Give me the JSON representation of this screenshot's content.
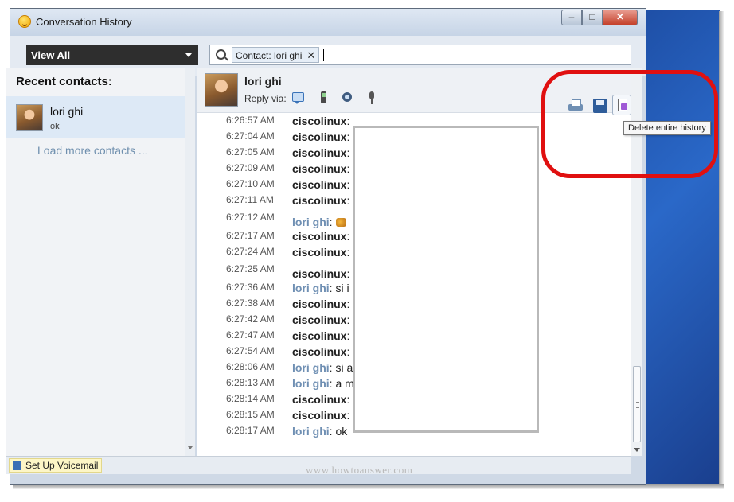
{
  "window": {
    "title": "Conversation History"
  },
  "toolbar": {
    "view_filter": "View All",
    "search_chip": "Contact: lori ghi"
  },
  "sidebar": {
    "heading": "Recent contacts:",
    "contacts": [
      {
        "name": "lori ghi",
        "status": "ok"
      }
    ],
    "load_more": "Load more contacts ..."
  },
  "conversation": {
    "contact_name": "lori ghi",
    "reply_via_label": "Reply via:",
    "tooltip": "Delete entire history",
    "messages": [
      {
        "time": "6:26:57 AM",
        "sender": "ciscolinux",
        "text": ":"
      },
      {
        "time": "6:27:04 AM",
        "sender": "ciscolinux",
        "text": ":"
      },
      {
        "time": "6:27:05 AM",
        "sender": "ciscolinux",
        "text": ":"
      },
      {
        "time": "6:27:09 AM",
        "sender": "ciscolinux",
        "text": ":"
      },
      {
        "time": "6:27:10 AM",
        "sender": "ciscolinux",
        "text": ":"
      },
      {
        "time": "6:27:11 AM",
        "sender": "ciscolinux",
        "text": ":"
      },
      {
        "time": "6:27:12 AM",
        "sender": "lori ghi",
        "text": ":"
      },
      {
        "time": "6:27:17 AM",
        "sender": "ciscolinux",
        "text": ":"
      },
      {
        "time": "6:27:24 AM",
        "sender": "ciscolinux",
        "text": ":"
      },
      {
        "time": "6:27:25 AM",
        "sender": "ciscolinux",
        "text": ":"
      },
      {
        "time": "6:27:36 AM",
        "sender": "lori ghi",
        "text": ": si i"
      },
      {
        "time": "6:27:38 AM",
        "sender": "ciscolinux",
        "text": ":"
      },
      {
        "time": "6:27:42 AM",
        "sender": "ciscolinux",
        "text": ":"
      },
      {
        "time": "6:27:47 AM",
        "sender": "ciscolinux",
        "text": ":"
      },
      {
        "time": "6:27:54 AM",
        "sender": "ciscolinux",
        "text": ":"
      },
      {
        "time": "6:28:06 AM",
        "sender": "lori ghi",
        "text": ": si a"
      },
      {
        "time": "6:28:13 AM",
        "sender": "lori ghi",
        "text": ": a m"
      },
      {
        "time": "6:28:14 AM",
        "sender": "ciscolinux",
        "text": ":"
      },
      {
        "time": "6:28:15 AM",
        "sender": "ciscolinux",
        "text": ":"
      },
      {
        "time": "6:28:17 AM",
        "sender": "lori ghi",
        "text": ": ok"
      }
    ]
  },
  "statusbar": {
    "voicemail": "Set Up Voicemail",
    "watermark": "www.howtoanswer.com"
  },
  "colors": {
    "highlight_ring": "#e01010",
    "contact_link": "#6f8fb3",
    "selected_row": "#dde9f6"
  },
  "icons": [
    "messenger-smiley-icon",
    "search-icon",
    "chat-icon",
    "mobile-phone-icon",
    "video-call-icon",
    "microphone-icon",
    "print-icon",
    "save-icon",
    "delete-history-icon",
    "voicemail-icon"
  ]
}
